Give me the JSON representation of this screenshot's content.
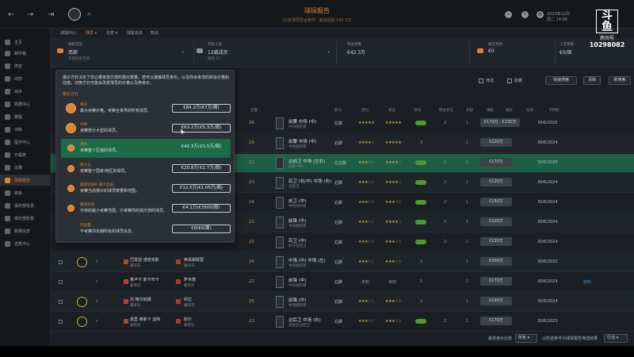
{
  "topbar": {
    "page_title": "球探报告",
    "page_sub": "12名球员符合条件 · 最高估值 €42.3万",
    "date": "2023年12月",
    "date_sub": "周二 14:00",
    "overlay": {
      "logo": "斗鱼",
      "sub": "房间号",
      "room": "10298082"
    }
  },
  "sidebar": {
    "items": [
      {
        "label": "主页"
      },
      {
        "label": "邮件箱"
      },
      {
        "label": "阵容"
      },
      {
        "label": "动态"
      },
      {
        "label": "战术"
      },
      {
        "label": "数据中心"
      },
      {
        "label": "赛程"
      },
      {
        "label": "训练"
      },
      {
        "label": "医疗中心"
      },
      {
        "label": "日程表"
      },
      {
        "label": "比赛"
      },
      {
        "label": "球探报告"
      },
      {
        "label": "转会"
      },
      {
        "label": "俱乐部信息"
      },
      {
        "label": "俱乐部愿景"
      },
      {
        "label": "联赛信息"
      },
      {
        "label": "选秀中心"
      }
    ],
    "active_index": 11
  },
  "tabs": {
    "items": [
      {
        "label": "球探中心"
      },
      {
        "label": "球员 ▾"
      },
      {
        "label": "任务 ▾"
      },
      {
        "label": "球星名单"
      },
      {
        "label": "知识"
      }
    ],
    "active_index": 1
  },
  "filters": {
    "scout": {
      "label": "搜索范围",
      "value": "南部",
      "sub": "专属搜索范围"
    },
    "age": {
      "label": "年龄上限",
      "value": "12威成员",
      "sub": "最低 €7"
    },
    "budget": {
      "label": "转会预算",
      "value": "€42.3万",
      "sub": ""
    },
    "report": {
      "label": "报告费用",
      "value": "€0",
      "sub": ""
    },
    "wage": {
      "label": "工资预算",
      "value": "€0/周",
      "sub": ""
    }
  },
  "toolbar": {
    "option1": "筛选",
    "option2": "隐藏",
    "quick_search": "快速搜索",
    "clear": "清除",
    "new_search": "新搜索"
  },
  "columns": [
    "位置",
    "能力",
    "潜力",
    "状态",
    "合同",
    "转会状态",
    "年龄",
    "球龄",
    "报价",
    "估值",
    "卡到期"
  ],
  "rows": [
    {
      "num": "26",
      "name": "前腰 中场 (中)",
      "sub": "中场组织者",
      "foot": "右脚",
      "ab": "★★★★★",
      "pot": "★★★★★",
      "a": "2",
      "b": "1",
      "badge": "€170万 - €235万",
      "date": "30/6/2025"
    },
    {
      "num": "29",
      "name": "前腰 中场 (中)",
      "sub": "中场组织者",
      "foot": "右脚",
      "ab": "★★★★☆",
      "pot": "★★★★★",
      "a": "3",
      "b": "1",
      "badge": "€220万",
      "date": "30/6/2024"
    },
    {
      "num": "21",
      "name": "边前卫 中场 (左右)",
      "sub": "前腰 (中)",
      "foot": "左右脚",
      "ab": "★★★☆☆",
      "pot": "★★★★☆",
      "a": "1",
      "b": "1",
      "badge": "€170万",
      "date": "30/6/2026"
    },
    {
      "num": "23",
      "name": "后卫 (右/中) 中场 (右)",
      "sub": "边后卫",
      "foot": "右脚",
      "ab": "★★★☆☆",
      "pot": "★★★★☆",
      "a": "2",
      "b": "1",
      "badge": "€120万",
      "date": "30/6/2024"
    },
    {
      "num": "24",
      "name": "前卫 (中)",
      "sub": "中场组织者",
      "foot": "右脚",
      "ab": "★★★☆☆",
      "pot": "★★★☆☆",
      "a": "2",
      "b": "1",
      "badge": "€150万",
      "date": "30/6/2024"
    },
    {
      "num": "22",
      "name": "前锋 (中)",
      "sub": "中场组织者",
      "foot": "右脚",
      "ab": "★★★☆☆",
      "pot": "★★★★☆",
      "a": "2",
      "b": "1",
      "badge": "€220万",
      "date": "30/6/2024"
    },
    {
      "num": "25",
      "name": "后卫 (中)",
      "sub": "防守型后卫",
      "foot": "右脚",
      "ab": "★★★☆☆",
      "pot": "★★★☆☆",
      "a": "2",
      "b": "1",
      "badge": "€220万",
      "date": "30/6/2024"
    },
    {
      "num": "24",
      "name": "中场 (中) 中场 (左)",
      "sub": "中场组织者",
      "foot": "右脚",
      "ab": "★★★☆☆",
      "pot": "★★★☆☆",
      "a": "2",
      "b": "1",
      "badge": "€200万",
      "date": "30/6/2025",
      "left_name": "巴雷迪 诺塔克斯",
      "left_sub": "葡萄牙",
      "left_name2": "西哥斯联盟",
      "left_sub2": "葡萄牙"
    },
    {
      "num": "22",
      "name": "前锋 (中)",
      "sub": "中场组织者",
      "foot": "右脚",
      "ab": "未知",
      "pot": "未知",
      "a": "1",
      "b": "1",
      "badge": "€170万",
      "date": "30/6/2024",
      "left_name": "奥卢卡 斯卡布卡",
      "left_sub": "葡萄牙",
      "left_name2": "萨韦德",
      "left_sub2": "葡萄牙",
      "link": "转到"
    },
    {
      "num": "25",
      "name": "前锋 (中)",
      "sub": "中场组织者",
      "foot": "右脚",
      "ab": "★★★☆☆",
      "pot": "★★★☆☆",
      "a": "2",
      "b": "1",
      "badge": "€190万",
      "date": "30/6/2024",
      "left_name": "托 格尔纳姆",
      "left_sub": "葡萄牙",
      "left_name2": "科拉",
      "left_sub2": "葡萄牙"
    },
    {
      "num": "23",
      "name": "边后卫 中场 (右)",
      "sub": "进攻型边后卫",
      "foot": "右脚",
      "ab": "★★★☆☆",
      "pot": "★★★☆☆",
      "a": "2",
      "b": "1",
      "badge": "€170万",
      "date": "30/6/2025",
      "left_name": "茹里 奥斯卡 迪特",
      "left_sub": "葡萄牙",
      "left_name2": "耐尔",
      "left_sub2": "葡萄牙"
    }
  ],
  "footer": {
    "label1": "最佳身价比较",
    "select1": "所有 ▾",
    "label2": "以所选条件为球探报告筛选结果",
    "select2": "行动 ▾"
  },
  "popup": {
    "description": "报价方针决定了你让哪家俱乐部的报价数量。若可以接触球员身份，以及你会考虑的转会价格和估值。切换方针可能会改变球员的价格以及参考价。",
    "section_title": "报价方针",
    "options": [
      {
        "name": "保守",
        "desc": "最大考察价格。考察全世界的所有球员。",
        "value": "€84.2万(€7万/周)"
      },
      {
        "name": "均衡",
        "desc": "考察部分大型的球员。",
        "value": "€63.2万(€5.3万/周)"
      },
      {
        "name": "激进",
        "desc": "考察整个区域的球员。",
        "value": "€42.3万(€3.5万/周)"
      },
      {
        "name": "最大化",
        "desc": "考察整个国家/地区的球员。",
        "value": "€20.8万(€1.7万/周)"
      },
      {
        "name": "最受欢迎的 最大自由",
        "desc": "考察当前报价的球员数量和范围。",
        "value": "€12.5万(€1.05万/周)"
      },
      {
        "name": "最受欢迎",
        "desc": "可用的最小考察范围，只考察你的俱乐部的球员。",
        "value": "€4.1万(€3500/周)"
      },
      {
        "name": "无设置",
        "desc": "不考察你长期所有的球员信息。",
        "value": "€0(€0/周)"
      }
    ],
    "selected_index": 2
  }
}
